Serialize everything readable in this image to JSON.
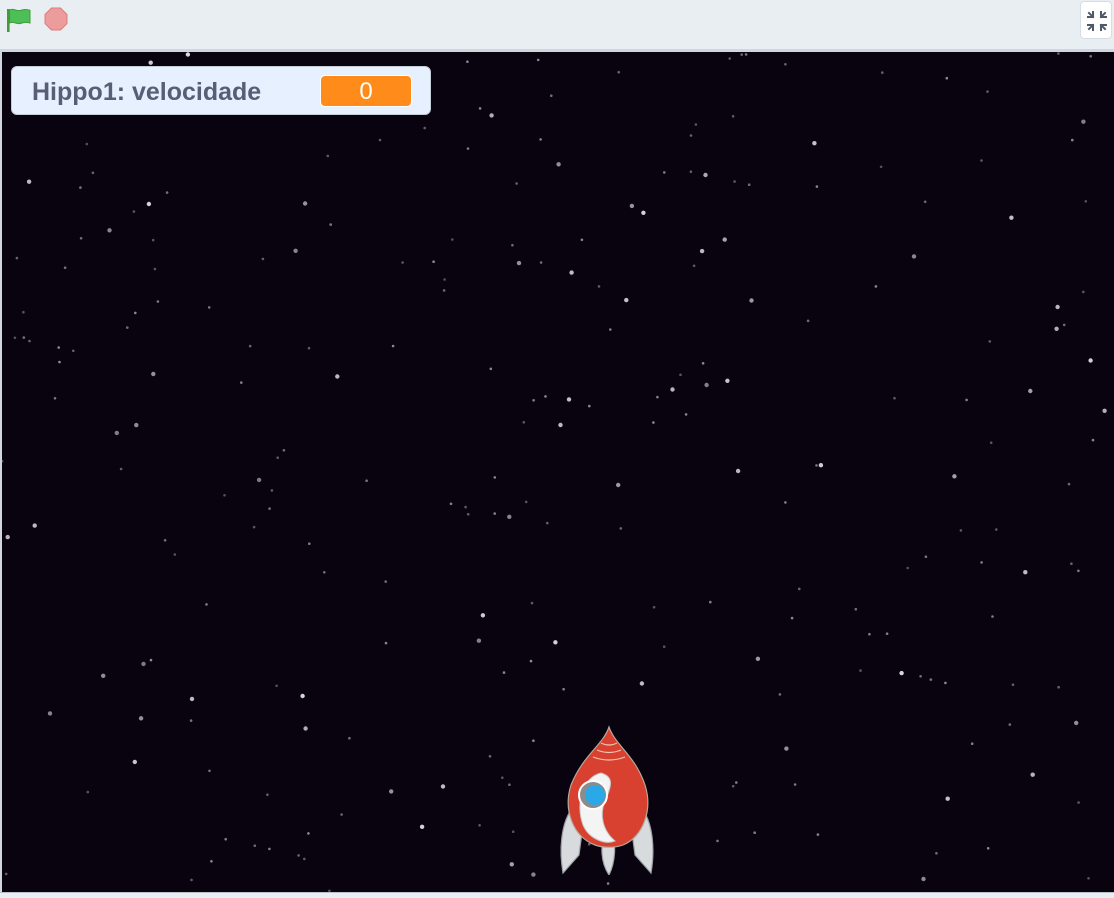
{
  "controls": {
    "green_flag_icon": "green-flag-icon",
    "stop_icon": "stop-sign-icon",
    "fullscreen_icon": "exit-fullscreen-icon"
  },
  "monitor": {
    "label": "Hippo1: velocidade",
    "value": "0"
  },
  "sprite": {
    "icon": "rocket-sprite"
  },
  "colors": {
    "stage_background": "#09030f",
    "monitor_background": "#e6f0ff",
    "monitor_value": "#ff8c1a",
    "flag_green": "#4caf50",
    "stop_red": "#ec9c9c",
    "rocket_red": "#d8412f"
  }
}
